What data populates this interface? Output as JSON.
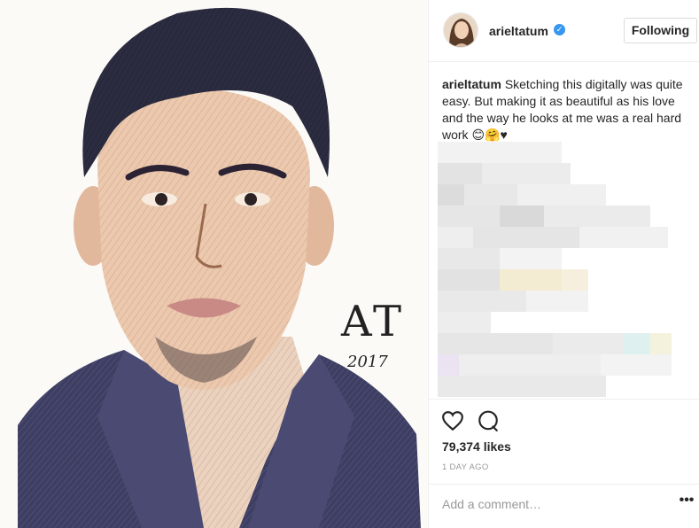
{
  "post": {
    "username": "arieltatum",
    "follow_label": "Following",
    "caption_user": "arieltatum",
    "caption_text": "Sketching this digitally was quite easy. But making it as beautiful as his love and the way he looks at me was a real hard work 😊🤗♥",
    "likes": "79,374 likes",
    "time": "1 DAY AGO",
    "comment_placeholder": "Add a comment…",
    "more_label": "•••"
  },
  "artwork": {
    "signature": "AT",
    "year": "2017"
  },
  "icons": {
    "verified": "verified-badge-icon",
    "like": "heart-icon",
    "comment": "comment-bubble-icon",
    "more": "more-options-icon"
  },
  "colors": {
    "verified_blue": "#3897f0",
    "text": "#262626",
    "muted": "#999999",
    "border": "#dbdbdb"
  }
}
